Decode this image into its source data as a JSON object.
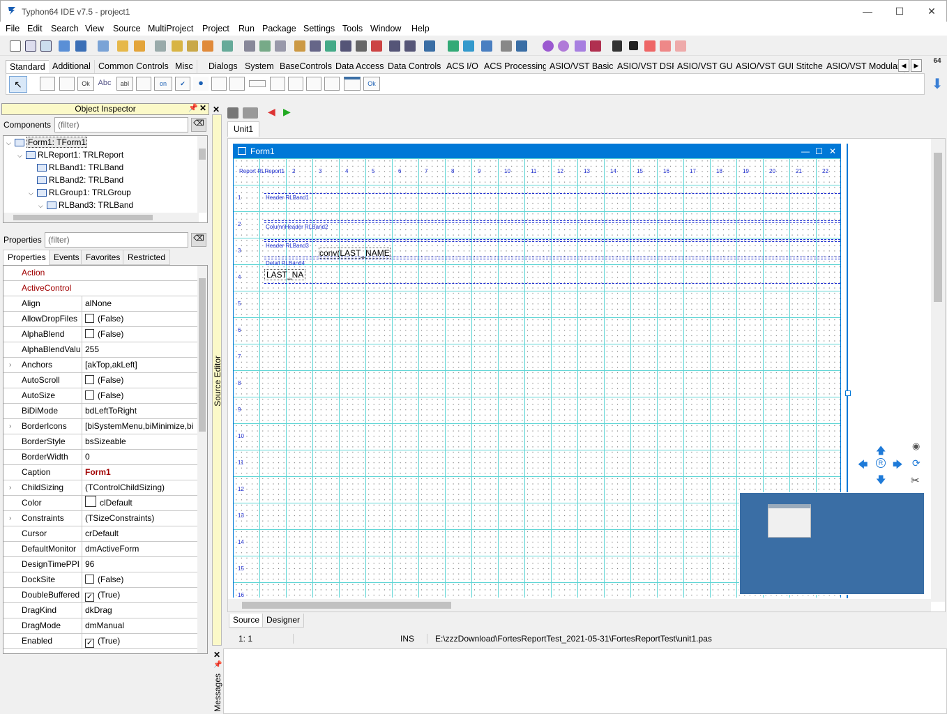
{
  "window": {
    "title": "Typhon64 IDE v7.5 - project1",
    "minimize": "—",
    "maximize": "☐",
    "close": "✕"
  },
  "menu": [
    "File",
    "Edit",
    "Search",
    "View",
    "Source",
    "MultiProject",
    "Project",
    "Run",
    "Package",
    "Settings",
    "Tools",
    "Window",
    "Help"
  ],
  "palette": {
    "tabs": [
      "Standard",
      "Additional",
      "Common Controls",
      "Misc",
      "Dialogs",
      "System",
      "BaseControls",
      "Data Access",
      "Data Controls",
      "ACS I/O",
      "ACS Processing",
      "ASIO/VST Basics",
      "ASIO/VST DSP",
      "ASIO/VST GUI",
      "ASIO/VST GUI Stitched",
      "ASIO/VST Modular"
    ],
    "active_tab": "Standard",
    "components": [
      "",
      "",
      "",
      "Ok",
      "Abc",
      "abI",
      "",
      "on",
      "✔",
      "●",
      "",
      "",
      "",
      "",
      "",
      "",
      "",
      "",
      "Ok"
    ],
    "badge": "64"
  },
  "object_inspector": {
    "title": "Object Inspector",
    "components_label": "Components",
    "filter_placeholder": "(filter)",
    "tree": [
      {
        "label": "Form1: TForm1",
        "level": 0,
        "expanded": true,
        "selected": true
      },
      {
        "label": "RLReport1: TRLReport",
        "level": 1,
        "expanded": true
      },
      {
        "label": "RLBand1: TRLBand",
        "level": 2
      },
      {
        "label": "RLBand2: TRLBand",
        "level": 2
      },
      {
        "label": "RLGroup1: TRLGroup",
        "level": 2,
        "expanded": true
      },
      {
        "label": "RLBand3: TRLBand",
        "level": 3,
        "expanded": true
      }
    ],
    "properties_label": "Properties",
    "tabs": [
      "Properties",
      "Events",
      "Favorites",
      "Restricted"
    ],
    "active_tab": "Properties",
    "props": [
      {
        "name": "Action",
        "value": "",
        "red": true
      },
      {
        "name": "ActiveControl",
        "value": "",
        "red": true
      },
      {
        "name": "Align",
        "value": "alNone"
      },
      {
        "name": "AllowDropFiles",
        "value": "(False)",
        "check": false
      },
      {
        "name": "AlphaBlend",
        "value": "(False)",
        "check": false
      },
      {
        "name": "AlphaBlendValu",
        "value": "255"
      },
      {
        "name": "Anchors",
        "value": "[akTop,akLeft]",
        "expand": true
      },
      {
        "name": "AutoScroll",
        "value": "(False)",
        "check": false
      },
      {
        "name": "AutoSize",
        "value": "(False)",
        "check": false
      },
      {
        "name": "BiDiMode",
        "value": "bdLeftToRight"
      },
      {
        "name": "BorderIcons",
        "value": "[biSystemMenu,biMinimize,bi",
        "expand": true
      },
      {
        "name": "BorderStyle",
        "value": "bsSizeable"
      },
      {
        "name": "BorderWidth",
        "value": "0"
      },
      {
        "name": "Caption",
        "value": "Form1",
        "bold": true
      },
      {
        "name": "ChildSizing",
        "value": "(TControlChildSizing)",
        "expand": true
      },
      {
        "name": "Color",
        "value": "clDefault",
        "swatch": true
      },
      {
        "name": "Constraints",
        "value": "(TSizeConstraints)",
        "expand": true
      },
      {
        "name": "Cursor",
        "value": "crDefault"
      },
      {
        "name": "DefaultMonitor",
        "value": "dmActiveForm"
      },
      {
        "name": "DesignTimePPI",
        "value": "96"
      },
      {
        "name": "DockSite",
        "value": "(False)",
        "check": false
      },
      {
        "name": "DoubleBuffered",
        "value": "(True)",
        "check": true
      },
      {
        "name": "DragKind",
        "value": "dkDrag"
      },
      {
        "name": "DragMode",
        "value": "dmManual"
      },
      {
        "name": "Enabled",
        "value": "(True)",
        "check": true
      }
    ]
  },
  "editor": {
    "side_label": "Source Editor",
    "tab": "Unit1",
    "bottom_tabs": [
      "Source",
      "Designer"
    ],
    "active_bottom_tab": "Designer",
    "status": {
      "pos": "1:  1",
      "mode": "INS",
      "path": "E:\\zzzDownload\\FortesReportTest_2021-05-31\\FortesReportTest\\unit1.pas"
    },
    "messages_label": "Messages"
  },
  "form": {
    "title": "Form1",
    "report_label": "Report RLReport1",
    "bands": [
      {
        "label": "Header RLBand1"
      },
      {
        "label": "ColumnHeader RLBand2"
      },
      {
        "label": "Header RLBand3",
        "text": "conv(LAST_NAME"
      },
      {
        "label": "Detail RLBand4",
        "text": "LAST_NA"
      }
    ],
    "ruler_top": [
      "2",
      "3",
      "4",
      "5",
      "6",
      "7",
      "8",
      "9",
      "10",
      "11",
      "12",
      "13",
      "14",
      "15",
      "16",
      "17",
      "18",
      "19",
      "20",
      "21",
      "22"
    ],
    "ruler_left": [
      "1",
      "2",
      "3",
      "4",
      "5",
      "6",
      "7",
      "8",
      "9",
      "10",
      "11",
      "12",
      "13",
      "14",
      "15",
      "16"
    ]
  }
}
